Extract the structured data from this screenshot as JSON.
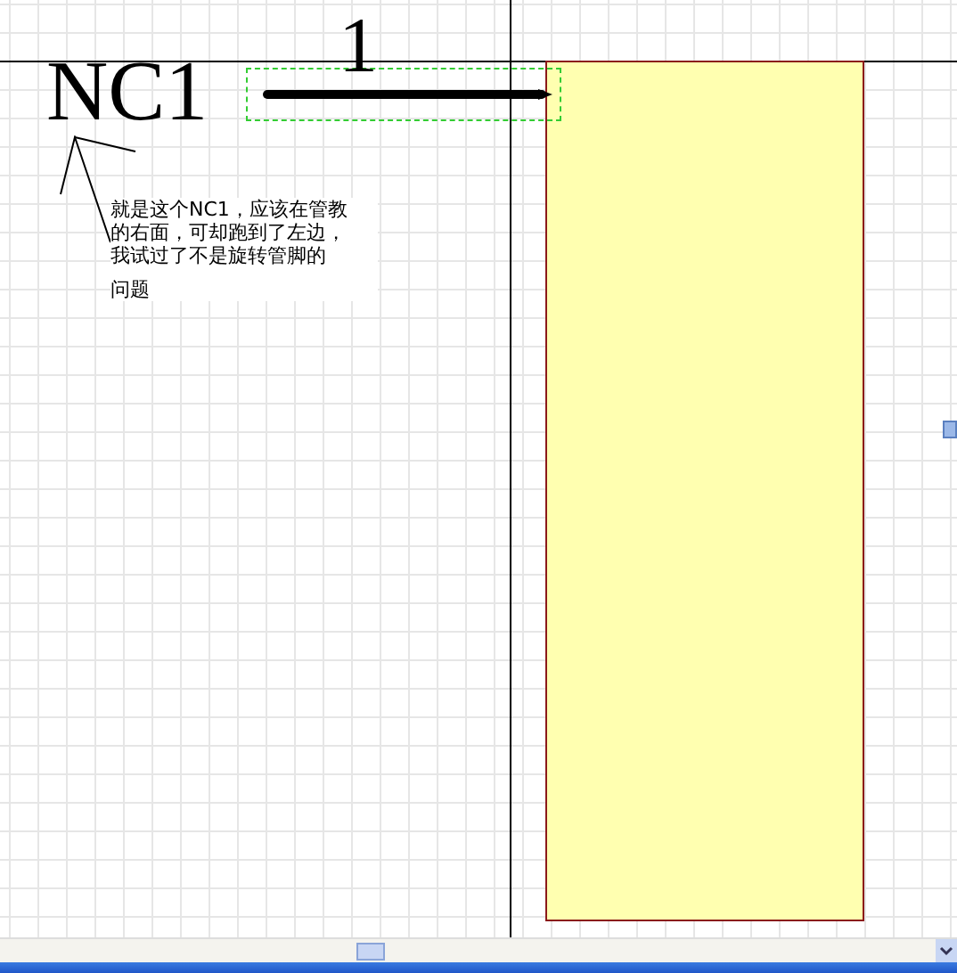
{
  "pin": {
    "name": "NC1",
    "number": "1",
    "selected": true
  },
  "note": {
    "lines": [
      "就是这个NC1，应该在管教",
      "的右面，可却跑到了左边，",
      "我试过了不是旋转管脚的",
      "问题"
    ]
  }
}
